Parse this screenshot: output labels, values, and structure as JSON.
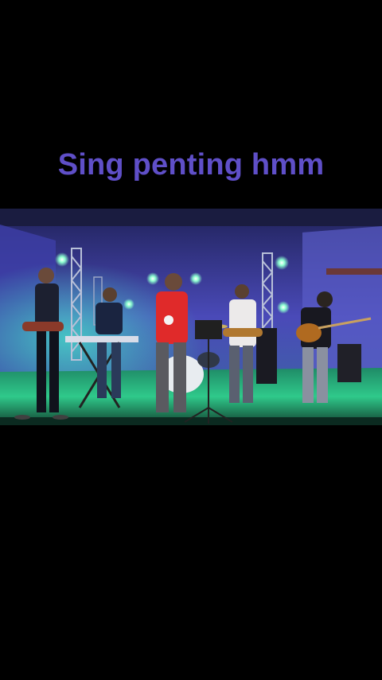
{
  "overlay": {
    "caption": "Sing penting hmm",
    "caption_color": "#5f4fc8"
  },
  "video": {
    "scene": "band-performing-on-stage",
    "colors": {
      "backdrop": "#4a4ab8",
      "floor_light": "#2fc98a",
      "floor_dark": "#0f3d2e",
      "spot_light": "#8cffd0",
      "singer_shirt": "#e02a2a"
    }
  }
}
